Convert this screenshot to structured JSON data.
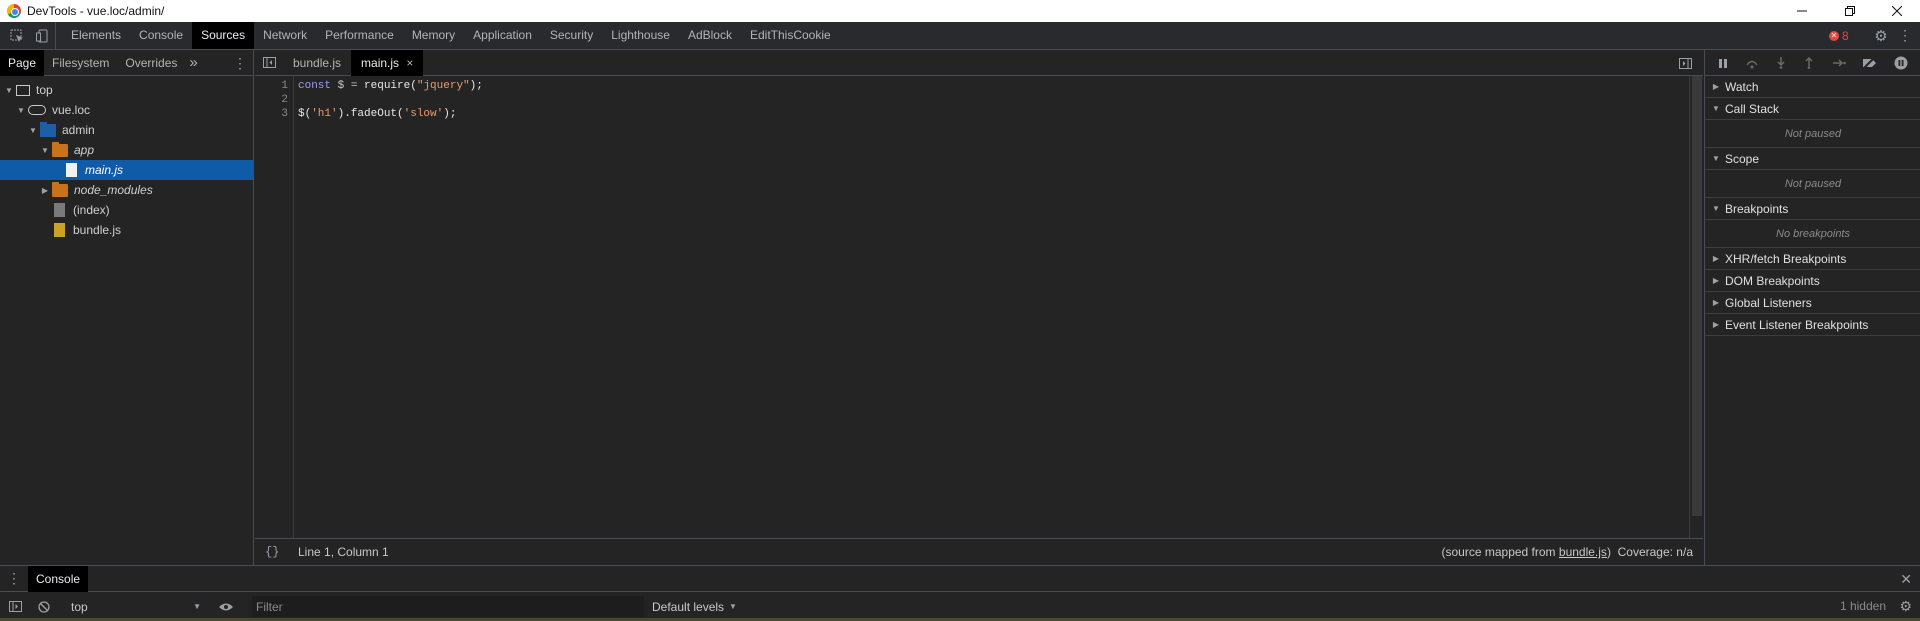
{
  "window": {
    "title": "DevTools - vue.loc/admin/",
    "minimize_icon": "minimize-icon",
    "maximize_icon": "restore-icon",
    "close_icon": "close-icon"
  },
  "main_tabs": {
    "items": [
      "Elements",
      "Console",
      "Sources",
      "Network",
      "Performance",
      "Memory",
      "Application",
      "Security",
      "Lighthouse",
      "AdBlock",
      "EditThisCookie"
    ],
    "active": "Sources",
    "error_count": "8"
  },
  "navigator": {
    "tabs": [
      "Page",
      "Filesystem",
      "Overrides"
    ],
    "active_tab": "Page",
    "more_label": "»",
    "tree": [
      {
        "label": "top",
        "depth": 0,
        "icon": "frame-icon",
        "expanded": true
      },
      {
        "label": "vue.loc",
        "depth": 1,
        "icon": "cloud-icon",
        "expanded": true
      },
      {
        "label": "admin",
        "depth": 2,
        "icon": "folder-icon",
        "expanded": true
      },
      {
        "label": "app",
        "depth": 3,
        "icon": "folder-icon",
        "expanded": true
      },
      {
        "label": "main.js",
        "depth": 4,
        "icon": "file-icon",
        "selected": true
      },
      {
        "label": "node_modules",
        "depth": 3,
        "icon": "folder-icon",
        "expanded": false
      },
      {
        "label": "(index)",
        "depth": 3,
        "icon": "file-icon"
      },
      {
        "label": "bundle.js",
        "depth": 3,
        "icon": "file-icon"
      }
    ]
  },
  "editor": {
    "tabs": [
      {
        "label": "bundle.js",
        "active": false
      },
      {
        "label": "main.js",
        "active": true,
        "close": "×"
      }
    ],
    "line_numbers": [
      "1",
      "2",
      "3"
    ],
    "code": {
      "line1": {
        "kw": "const",
        "var": " $",
        "op": " = ",
        "fn": "require(",
        "str": "\"jquery\"",
        "end": ");"
      },
      "line3": {
        "a": "$(",
        "s1": "'h1'",
        "b": ").fadeOut(",
        "s2": "'slow'",
        "c": ");"
      }
    },
    "status": {
      "format_label": "{}",
      "position": "Line 1, Column 1",
      "source_mapped_prefix": "(source mapped from ",
      "source_mapped_link": "bundle.js",
      "source_mapped_suffix": ")",
      "coverage": "Coverage: n/a"
    }
  },
  "debugger": {
    "panes": [
      {
        "title": "Watch",
        "expanded": false
      },
      {
        "title": "Call Stack",
        "expanded": true,
        "message": "Not paused"
      },
      {
        "title": "Scope",
        "expanded": true,
        "message": "Not paused"
      },
      {
        "title": "Breakpoints",
        "expanded": true,
        "message": "No breakpoints"
      },
      {
        "title": "XHR/fetch Breakpoints",
        "expanded": false
      },
      {
        "title": "DOM Breakpoints",
        "expanded": false
      },
      {
        "title": "Global Listeners",
        "expanded": false
      },
      {
        "title": "Event Listener Breakpoints",
        "expanded": false
      }
    ]
  },
  "drawer": {
    "tab": "Console",
    "context": "top",
    "filter_placeholder": "Filter",
    "levels": "Default levels",
    "hidden": "1 hidden"
  },
  "colors": {
    "background": "#242424",
    "selection": "#0f5ba8",
    "string": "#f29766",
    "keyword": "#9b9bff",
    "error": "#e8453c"
  }
}
